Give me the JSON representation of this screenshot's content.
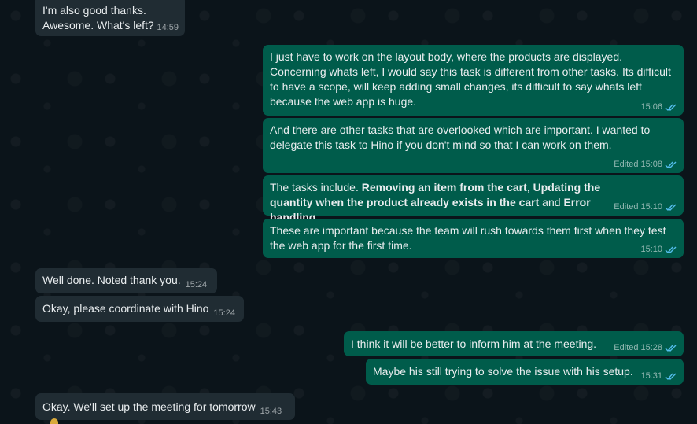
{
  "messages": [
    {
      "id": "m1",
      "dir": "in",
      "text": "I'm also good thanks.\nAwesome. What's left?",
      "time": "14:59",
      "edited": "",
      "read": false
    },
    {
      "id": "m2",
      "dir": "out",
      "text": "I just have to work on the layout body, where the products are displayed. Concerning whats left, I would say this task is different from other tasks. Its difficult to have a scope, will keep adding small changes, its difficult to say whats left because the web app is huge.",
      "time": "15:06",
      "edited": "",
      "read": true
    },
    {
      "id": "m3",
      "dir": "out",
      "text": "And there are other tasks that are overlooked which are important. I wanted to delegate this task to Hino if you don't mind so that I can work on them.",
      "time": "15:08",
      "edited": "Edited",
      "read": true
    },
    {
      "id": "m4",
      "dir": "out",
      "parts": {
        "p1": "The tasks include. ",
        "b1": "Removing an item from the cart",
        "p2": ", ",
        "b2": "Updating the quantity when the product already exists in the cart",
        "p3": " and ",
        "b3": "Error handling"
      },
      "time": "15:10",
      "edited": "Edited",
      "read": true
    },
    {
      "id": "m5",
      "dir": "out",
      "text": "These are important because the team will rush towards them first when they test the web app for the first time.",
      "time": "15:10",
      "edited": "",
      "read": true
    },
    {
      "id": "m6",
      "dir": "in",
      "text": "Well done. Noted thank you.",
      "time": "15:24",
      "edited": "",
      "read": false
    },
    {
      "id": "m7",
      "dir": "in",
      "text": "Okay, please coordinate with Hino",
      "time": "15:24",
      "edited": "",
      "read": false
    },
    {
      "id": "m8",
      "dir": "out",
      "text": "I think it will be better to inform him at the meeting.",
      "time": "15:28",
      "edited": "Edited",
      "read": true
    },
    {
      "id": "m9",
      "dir": "out",
      "text": "Maybe his still trying to solve the issue with his setup.",
      "time": "15:31",
      "edited": "",
      "read": true
    },
    {
      "id": "m10",
      "dir": "in",
      "text": "Okay. We'll set up the meeting for tomorrow",
      "time": "15:43",
      "edited": "",
      "read": false
    }
  ],
  "colors": {
    "background": "#0b141a",
    "incoming_bubble": "#202c33",
    "outgoing_bubble": "#005c4b",
    "text": "#e9edef",
    "read_ticks": "#53bdeb"
  },
  "icons": {
    "read_receipt": "double-check-icon"
  }
}
